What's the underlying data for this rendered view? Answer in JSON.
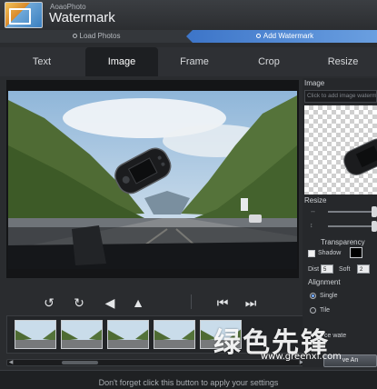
{
  "app": {
    "brand_small": "AoaoPhoto",
    "brand_big": "Watermark"
  },
  "steps": [
    {
      "label": "Load Photos"
    },
    {
      "label": "Add Watermark"
    }
  ],
  "tabs": [
    {
      "label": "Text"
    },
    {
      "label": "Image"
    },
    {
      "label": "Frame"
    },
    {
      "label": "Crop"
    },
    {
      "label": "Resize"
    }
  ],
  "active_tab": "Image",
  "panel": {
    "image_title": "Image",
    "add_image_placeholder": "Click to add image waterm",
    "resize_title": "Resize",
    "transparency_title": "Transparency",
    "shadow_label": "Shadow",
    "dist_label": "Dist",
    "dist_value": "5",
    "soft_label": "Soft",
    "soft_value": "2",
    "alignment_title": "Alignment",
    "single_label": "Single",
    "tile_label": "Tile",
    "apply_label": "ce wate",
    "save_label": "ve An"
  },
  "status_text": "Don't forget click this button to apply your settings",
  "overlay": {
    "cn": "绿色先锋",
    "url": "www.greenxf.com"
  },
  "colors": {
    "accent": "#3e76c9",
    "background": "#2a2c2f",
    "active_tab": "#1d1f22"
  },
  "icons": {
    "rotate_left": "rotate-left-icon",
    "rotate_right": "rotate-right-icon",
    "flip_horizontal": "flip-horizontal-icon",
    "flip_vertical": "flip-vertical-icon",
    "previous": "previous-icon",
    "next": "next-icon"
  }
}
